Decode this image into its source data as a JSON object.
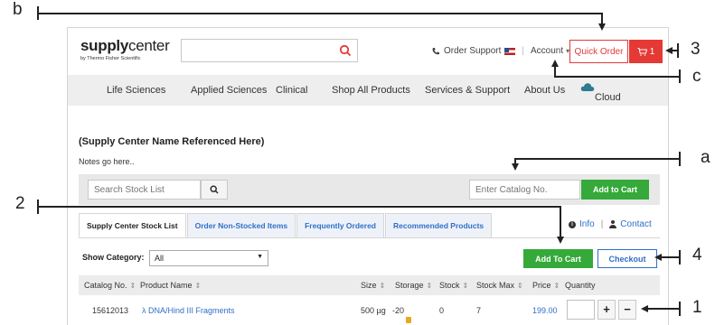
{
  "header": {
    "brand_bold": "supply",
    "brand_rest": "center",
    "brand_sub": "by Thermo Fisher Scientific",
    "search_placeholder": "",
    "order_support": "Order Support",
    "account": "Account",
    "account_caret": "▾",
    "separator": "|",
    "quick_order": "Quick Order",
    "cart_count": "1"
  },
  "nav": {
    "items": [
      "Life Sciences",
      "Applied Sciences",
      "Clinical",
      "Shop All Products",
      "Services & Support",
      "About Us",
      "Cloud"
    ]
  },
  "main": {
    "center_title": "(Supply Center Name Referenced Here)",
    "notes": "Notes go here..",
    "search_stock_placeholder": "Search Stock List",
    "catalog_placeholder": "Enter Catalog No.",
    "add_to_cart_top": "Add to Cart",
    "tabs": [
      "Supply Center Stock List",
      "Order Non-Stocked Items",
      "Frequently Ordered",
      "Recommended Products"
    ],
    "info_link": "Info",
    "contact_link": "Contact",
    "link_sep": "|",
    "show_category_label": "Show Category:",
    "category_value": "All",
    "add_to_cart_mid": "Add To Cart",
    "checkout": "Checkout"
  },
  "table": {
    "columns": [
      "Catalog No.",
      "Product Name",
      "Size",
      "Storage",
      "Stock",
      "Stock Max",
      "Price",
      "Quantity"
    ],
    "sort_glyph": "⇕",
    "rows": [
      {
        "catalog": "15612013",
        "product": "λ DNA/Hind III Fragments",
        "size": "500 µg",
        "storage": "-20",
        "stock": "0",
        "stock_max": "7",
        "price": "199.00"
      }
    ],
    "plus": "+",
    "minus": "−"
  },
  "callouts": {
    "b": "b",
    "c": "c",
    "a": "a",
    "n1": "1",
    "n2": "2",
    "n3": "3",
    "n4": "4"
  },
  "colors": {
    "accent_red": "#e53935",
    "accent_green": "#35a93a",
    "link_blue": "#2f6fc9"
  }
}
